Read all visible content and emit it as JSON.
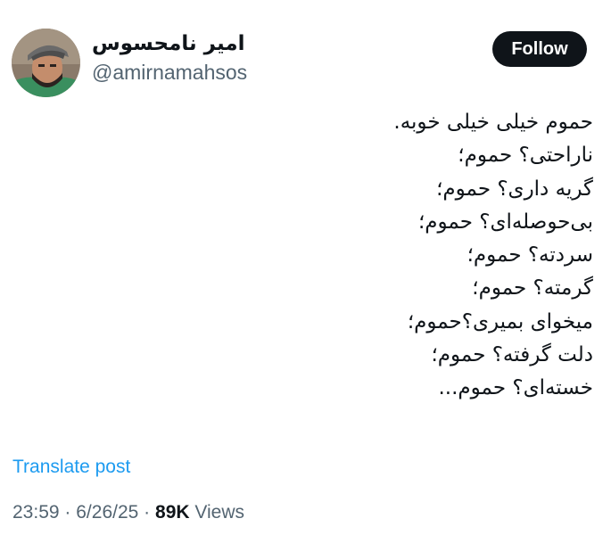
{
  "author": {
    "display_name": "امیر نامحسوس",
    "handle": "@amirnamahsos"
  },
  "follow_button": {
    "label": "Follow"
  },
  "tweet": {
    "lines": [
      "حموم خیلی خیلی خوبه.",
      "ناراحتی؟ حموم؛",
      "گریه داری؟ حموم؛",
      "بی‌حوصله‌ای؟ حموم؛",
      "سردته؟ حموم؛",
      "گرمته؟ حموم؛",
      "میخوای بمیری؟حموم؛",
      "دلت گرفته؟ حموم؛",
      "خسته‌ای؟ حموم..."
    ]
  },
  "translate": {
    "label": "Translate post"
  },
  "meta": {
    "time": "23:59",
    "separator": "·",
    "date": "6/26/25",
    "views_count": "89K",
    "views_label": "Views"
  },
  "colors": {
    "text_primary": "#0f1419",
    "text_secondary": "#536471",
    "link": "#1d9bf0",
    "button_bg": "#0f1419"
  }
}
